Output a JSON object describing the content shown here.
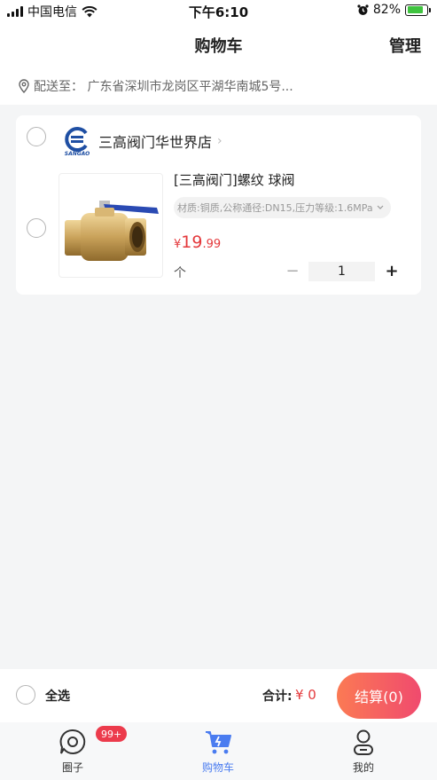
{
  "status_bar": {
    "carrier": "中国电信",
    "time": "下午6:10",
    "battery": "82%",
    "battery_level": 0.82
  },
  "header": {
    "title": "购物车",
    "manage": "管理"
  },
  "address": {
    "text": "配送至：  广东省深圳市龙岗区平湖华南城5号..."
  },
  "shop": {
    "name": "三高阀门华世界店",
    "logo_text": "SANGAO"
  },
  "item": {
    "title": "[三高阀门]螺纹 球阀",
    "spec": "材质:铜质,公称通径:DN15,压力等级:1.6MPa",
    "price_currency": "¥",
    "price_int": "19",
    "price_dec": ".99",
    "unit": "个",
    "quantity": "1",
    "minus": "−",
    "plus": "+"
  },
  "checkout": {
    "select_all": "全选",
    "total_label": "合计:",
    "total_value": "¥ 0",
    "button": "结算(0)"
  },
  "tabs": [
    {
      "label": "圈子",
      "icon": "chat-icon",
      "badge": "99+"
    },
    {
      "label": "购物车",
      "icon": "cart-icon",
      "active": true
    },
    {
      "label": "我的",
      "icon": "user-icon"
    }
  ],
  "colors": {
    "accent": "#e4393c",
    "tab_active": "#4a7cf0",
    "badge": "#ec3b4c"
  }
}
